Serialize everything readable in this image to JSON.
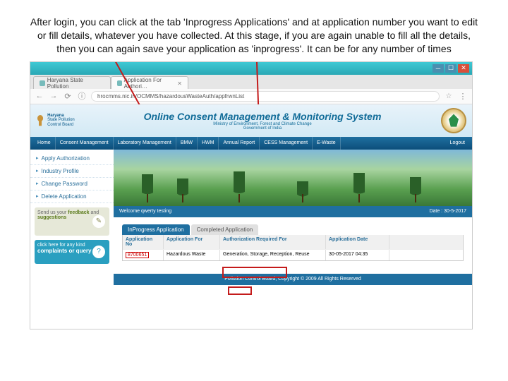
{
  "instruction_text": "After login, you can click at the tab 'Inprogress Applications' and at application number you want to edit or fill details, whatever you have collected. At this stage, if you are again unable to fill all the details, then you can again save your application as 'inprogress'. It can be for any number of times",
  "browser": {
    "tab1": "Haryana State Pollution",
    "tab2": "Application For Authori…",
    "url": "hrocmms.nic.in/OCMMS/hazardousWasteAuth/appfrwnList"
  },
  "header": {
    "brand_line1": "Haryana",
    "brand_line2": "State Pollution Control Board",
    "title": "Online Consent Management & Monitoring System",
    "sub1": "Ministry of Environment, Forest and Climate Change",
    "sub2": "Government of India"
  },
  "nav": {
    "i0": "Home",
    "i1": "Consent Management",
    "i2": "Laboratory Management",
    "i3": "BMW",
    "i4": "HWM",
    "i5": "Annual Report",
    "i6": "CESS Management",
    "i7": "E-Waste",
    "i8": "Logout"
  },
  "sidebar": {
    "s0": "Apply Authorization",
    "s1": "Industry Profile",
    "s2": "Change Password",
    "s3": "Delete Application",
    "feedback_line1": "Send us your",
    "feedback_bold": "feedback",
    "feedback_line2": "and",
    "feedback_bold2": "suggestions",
    "complaints_line1": "click here for any kind",
    "complaints_bold": "complaints or query"
  },
  "welcome": {
    "left": "Welcome qwerty testing",
    "right": "Date : 30-5-2017"
  },
  "apptabs": {
    "active": "InProgress Application",
    "inactive": "Completed Application"
  },
  "table": {
    "h1": "Application No",
    "h2": "Application For",
    "h3": "Authorization Required For",
    "h4": "Application Date",
    "r1c1": "8700651",
    "r1c2": "Hazardous Waste",
    "r1c3": "Generation, Storage, Reception, Reuse",
    "r1c4": "30-05-2017 04:35"
  },
  "footer": "Pollution Control Board, Copyright © 2009 All Rights Reserved"
}
